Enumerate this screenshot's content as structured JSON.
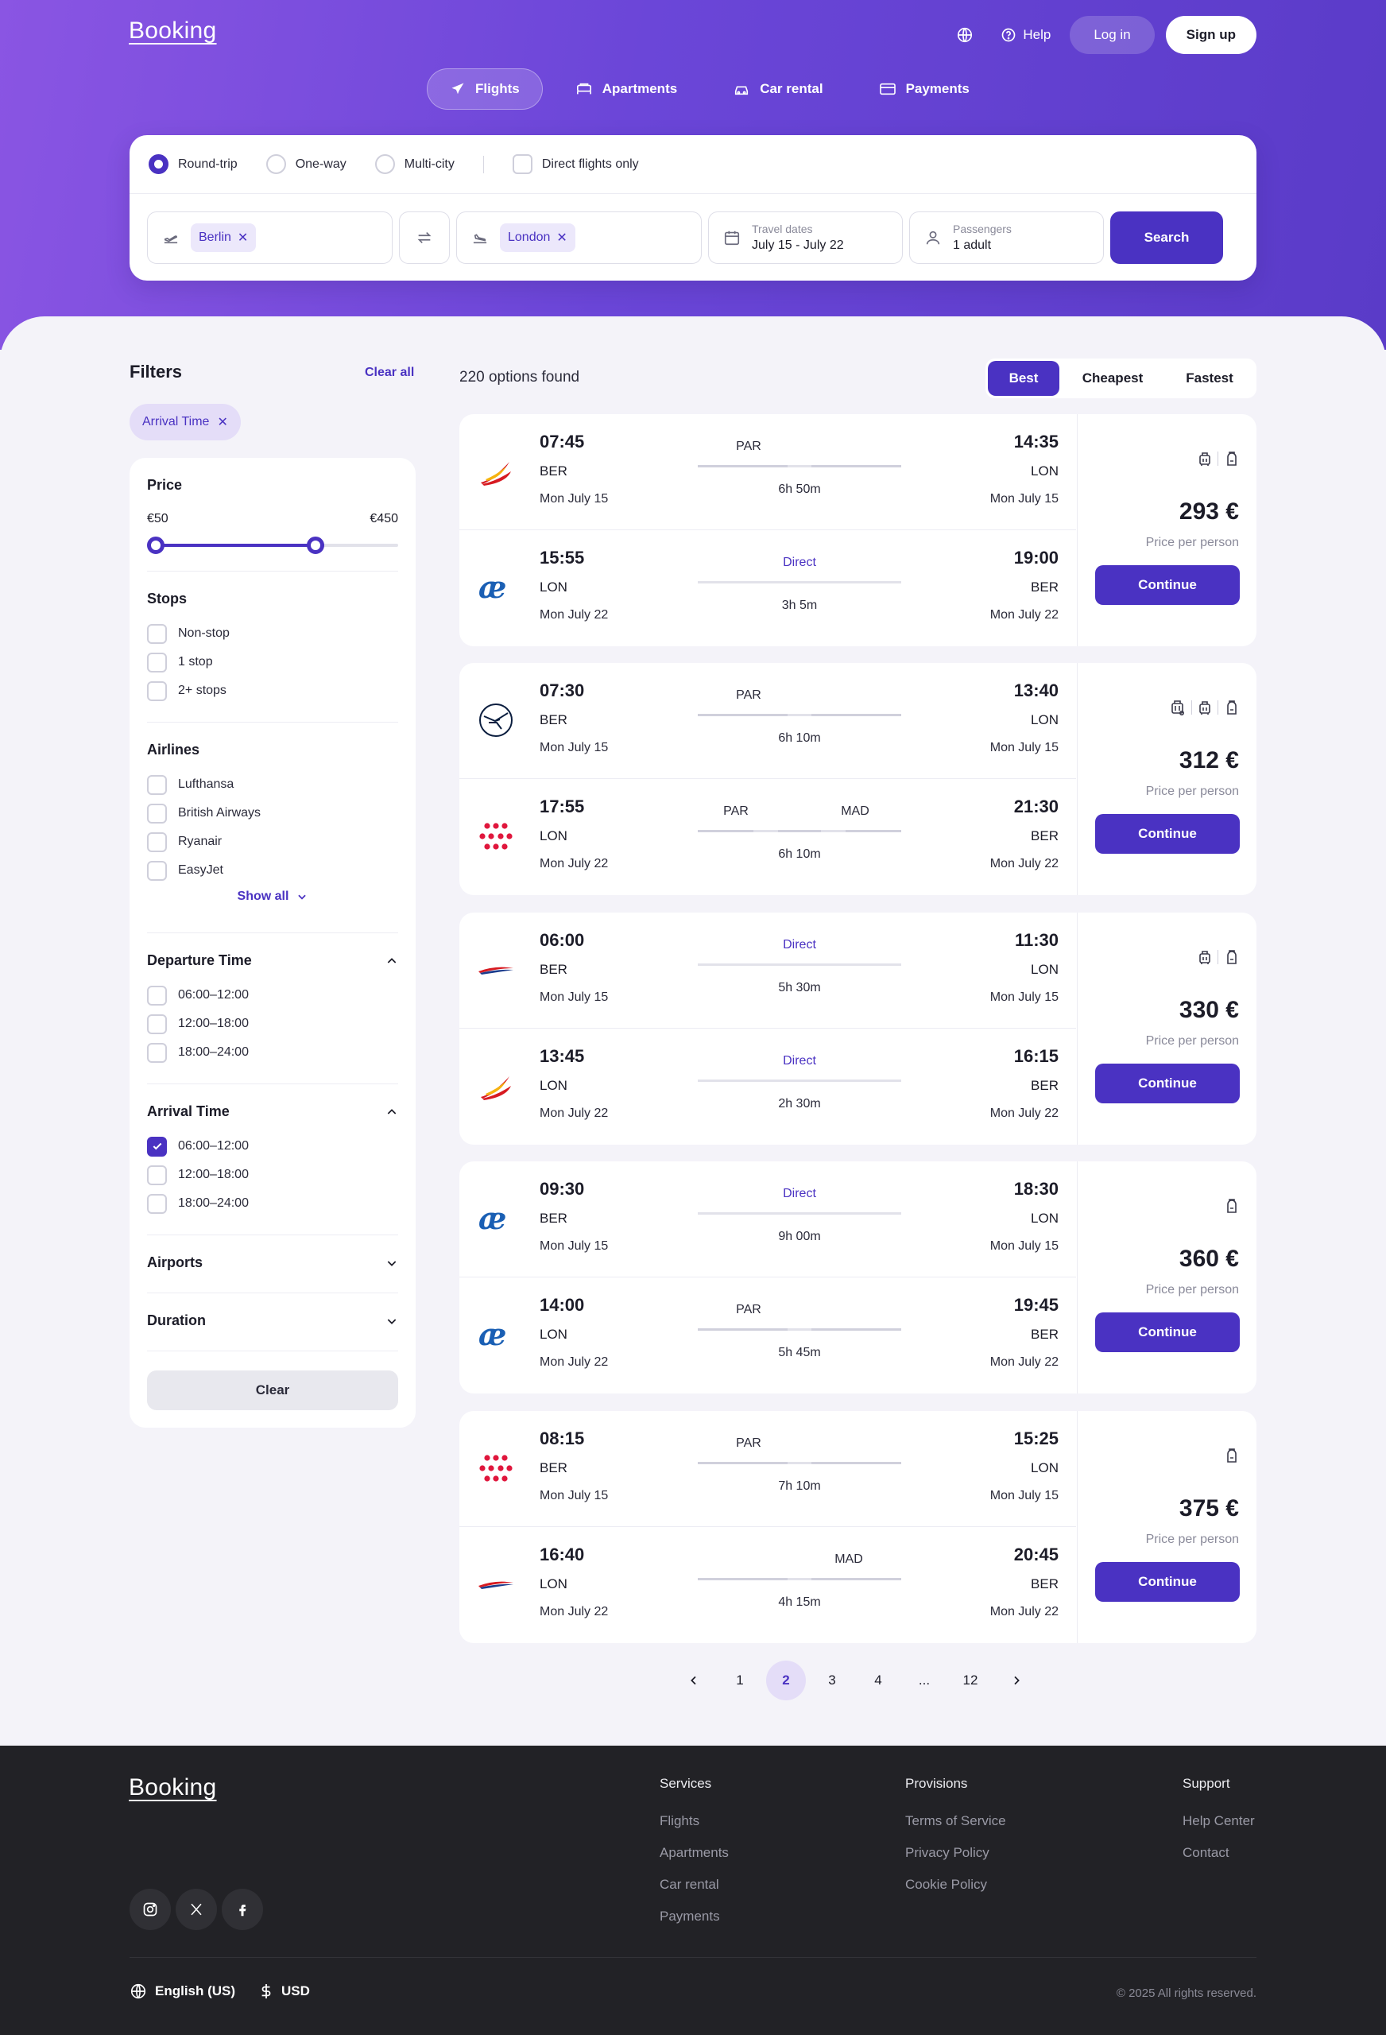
{
  "header": {
    "logo": "Booking",
    "help": "Help",
    "login": "Log in",
    "signup": "Sign up"
  },
  "tabs": [
    {
      "label": "Flights",
      "icon": "plane-icon"
    },
    {
      "label": "Apartments",
      "icon": "bed-icon"
    },
    {
      "label": "Car rental",
      "icon": "car-icon"
    },
    {
      "label": "Payments",
      "icon": "card-icon"
    }
  ],
  "search": {
    "trip_types": [
      "Round-trip",
      "One-way",
      "Multi-city"
    ],
    "direct_only": "Direct flights only",
    "from": "Berlin",
    "to": "London",
    "dates_label": "Travel dates",
    "dates_value": "July 15 - July 22",
    "passengers_label": "Passengers",
    "passengers_value": "1 adult",
    "search_button": "Search"
  },
  "filters": {
    "title": "Filters",
    "clear_all": "Clear all",
    "active_chip": "Arrival Time",
    "price": {
      "title": "Price",
      "min_label": "€50",
      "max_label": "€450",
      "range_low": 0,
      "range_high": 0.66
    },
    "stops": {
      "title": "Stops",
      "options": [
        "Non-stop",
        "1 stop",
        "2+ stops"
      ]
    },
    "airlines": {
      "title": "Airlines",
      "options": [
        "Lufthansa",
        "British Airways",
        "Ryanair",
        "EasyJet"
      ],
      "show_all": "Show all"
    },
    "departure": {
      "title": "Departure Time",
      "options": [
        "06:00–12:00",
        "12:00–18:00",
        "18:00–24:00"
      ]
    },
    "arrival": {
      "title": "Arrival Time",
      "options": [
        "06:00–12:00",
        "12:00–18:00",
        "18:00–24:00"
      ],
      "checked": 0
    },
    "airports": {
      "title": "Airports"
    },
    "duration": {
      "title": "Duration"
    },
    "clear": "Clear"
  },
  "results": {
    "count": "220 options found",
    "sort": [
      "Best",
      "Cheapest",
      "Fastest"
    ],
    "price_per_person": "Price per person",
    "continue": "Continue",
    "cards": [
      {
        "price": "293 €",
        "bags": [
          "cabin-bag-icon",
          "backpack-icon"
        ],
        "legs": [
          {
            "airline": "iberia",
            "dep": "07:45",
            "from": "BER",
            "dep_date": "Mon  July 15",
            "arr": "14:35",
            "to": "LON",
            "arr_date": "Mon  July 15",
            "stops": [
              "PAR"
            ],
            "duration": "6h 50m"
          },
          {
            "airline": "aireuropa",
            "dep": "15:55",
            "from": "LON",
            "dep_date": "Mon  July 22",
            "arr": "19:00",
            "to": "BER",
            "arr_date": "Mon  July 22",
            "stops": [
              "Direct"
            ],
            "duration": "3h 5m"
          }
        ]
      },
      {
        "price": "312 €",
        "bags": [
          "checked-bag-icon",
          "cabin-bag-icon",
          "backpack-icon"
        ],
        "legs": [
          {
            "airline": "lufthansa",
            "dep": "07:30",
            "from": "BER",
            "dep_date": "Mon  July 15",
            "arr": "13:40",
            "to": "LON",
            "arr_date": "Mon  July 15",
            "stops": [
              "PAR"
            ],
            "duration": "6h 10m"
          },
          {
            "airline": "dots",
            "dep": "17:55",
            "from": "LON",
            "dep_date": "Mon  July 22",
            "arr": "21:30",
            "to": "BER",
            "arr_date": "Mon  July 22",
            "stops": [
              "PAR",
              "MAD"
            ],
            "duration": "6h 10m"
          }
        ]
      },
      {
        "price": "330 €",
        "bags": [
          "cabin-bag-icon",
          "backpack-icon"
        ],
        "legs": [
          {
            "airline": "british",
            "dep": "06:00",
            "from": "BER",
            "dep_date": "Mon  July 15",
            "arr": "11:30",
            "to": "LON",
            "arr_date": "Mon  July 15",
            "stops": [
              "Direct"
            ],
            "duration": "5h 30m"
          },
          {
            "airline": "iberia",
            "dep": "13:45",
            "from": "LON",
            "dep_date": "Mon  July 22",
            "arr": "16:15",
            "to": "BER",
            "arr_date": "Mon  July 22",
            "stops": [
              "Direct"
            ],
            "duration": "2h 30m"
          }
        ]
      },
      {
        "price": "360 €",
        "bags": [
          "backpack-icon"
        ],
        "legs": [
          {
            "airline": "aireuropa",
            "dep": "09:30",
            "from": "BER",
            "dep_date": "Mon  July 15",
            "arr": "18:30",
            "to": "LON",
            "arr_date": "Mon  July 15",
            "stops": [
              "Direct"
            ],
            "duration": "9h 00m"
          },
          {
            "airline": "aireuropa",
            "dep": "14:00",
            "from": "LON",
            "dep_date": "Mon  July 22",
            "arr": "19:45",
            "to": "BER",
            "arr_date": "Mon  July 22",
            "stops": [
              "PAR"
            ],
            "duration": "5h 45m"
          }
        ]
      },
      {
        "price": "375 €",
        "bags": [
          "backpack-icon"
        ],
        "legs": [
          {
            "airline": "dots",
            "dep": "08:15",
            "from": "BER",
            "dep_date": "Mon  July 15",
            "arr": "15:25",
            "to": "LON",
            "arr_date": "Mon  July 15",
            "stops": [
              "PAR"
            ],
            "duration": "7h 10m"
          },
          {
            "airline": "british",
            "dep": "16:40",
            "from": "LON",
            "dep_date": "Mon  July 22",
            "arr": "20:45",
            "to": "BER",
            "arr_date": "Mon  July 22",
            "stops": [
              "MAD"
            ],
            "duration": "4h 15m"
          }
        ]
      }
    ]
  },
  "pagination": {
    "pages": [
      "1",
      "2",
      "3",
      "4",
      "...",
      "12"
    ],
    "active": "2"
  },
  "footer": {
    "logo": "Booking",
    "services": {
      "title": "Services",
      "links": [
        "Flights",
        "Apartments",
        "Car rental",
        "Payments"
      ]
    },
    "provisions": {
      "title": "Provisions",
      "links": [
        "Terms of Service",
        "Privacy Policy",
        "Cookie Policy"
      ]
    },
    "support": {
      "title": "Support",
      "links": [
        "Help Center",
        "Contact"
      ]
    },
    "language": "English (US)",
    "currency": "USD",
    "copyright": "© 2025 All rights reserved."
  },
  "colors": {
    "accent": "#4a32c2",
    "hero_start": "#8a55e3",
    "hero_end": "#5a3bc8",
    "footer_bg": "#222226"
  }
}
